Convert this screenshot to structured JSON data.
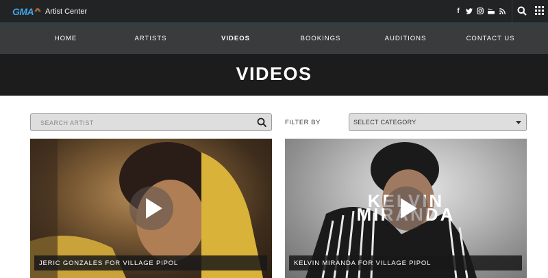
{
  "topbar": {
    "logo": "GMA",
    "site_name": "Artist Center",
    "social_icons": [
      "facebook-icon",
      "twitter-icon",
      "instagram-icon",
      "youtube-icon",
      "rss-icon"
    ]
  },
  "nav": {
    "items": [
      {
        "label": "HOME"
      },
      {
        "label": "ARTISTS"
      },
      {
        "label": "VIDEOS"
      },
      {
        "label": "BOOKINGS"
      },
      {
        "label": "AUDITIONS"
      },
      {
        "label": "CONTACT US"
      }
    ],
    "active": "VIDEOS"
  },
  "hero": {
    "title": "VIDEOS"
  },
  "search": {
    "placeholder": "SEARCH ARTIST",
    "value": ""
  },
  "filter": {
    "label": "FILTER BY",
    "selected": "SELECT CATEGORY"
  },
  "videos": [
    {
      "caption": "JERIC GONZALES FOR VILLAGE PIPOL"
    },
    {
      "caption": "KELVIN MIRANDA FOR VILLAGE PIPOL",
      "overlay_line1": "KELVIN",
      "overlay_line2": "MIRANDA"
    }
  ],
  "colors": {
    "topbar_bg": "#222324",
    "nav_bg": "#3a3b3c",
    "hero_bg": "#1c1c1c",
    "logo_blue": "#3fa6e6",
    "input_bg": "#dedede"
  }
}
